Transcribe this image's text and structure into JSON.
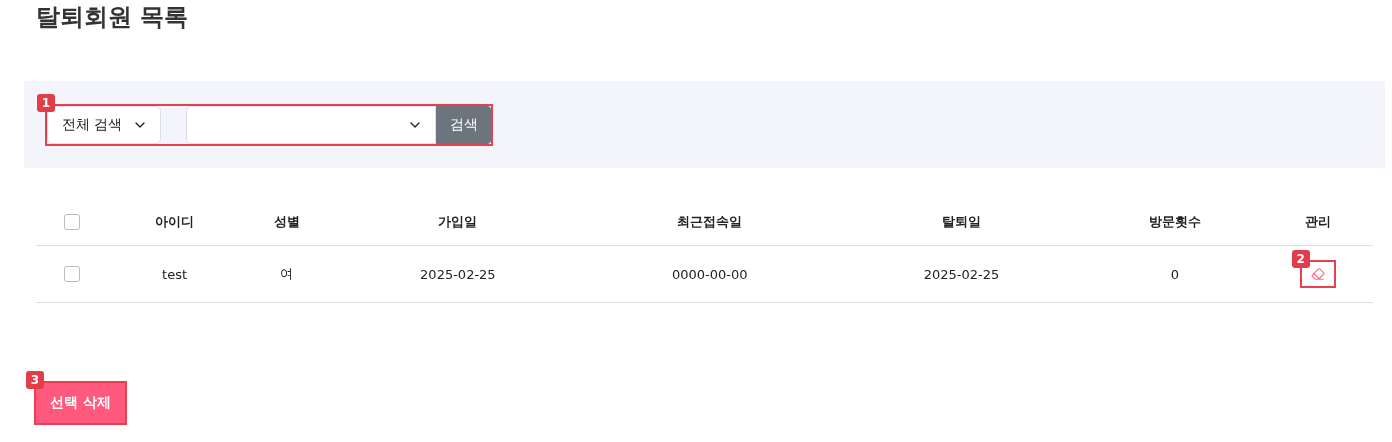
{
  "title": "탈퇴회원 목록",
  "search": {
    "marker": "1",
    "scope": "전체 검색",
    "button": "검색"
  },
  "table": {
    "columns": [
      "아이디",
      "성별",
      "가입일",
      "최근접속일",
      "탈퇴일",
      "방문횟수",
      "관리"
    ],
    "header_checked": false,
    "rows": [
      {
        "checked": false,
        "cells": [
          "test",
          "여",
          "2025-02-25",
          "0000-00-00",
          "2025-02-25",
          "0"
        ],
        "action_marker": "2"
      }
    ]
  },
  "delete_button": {
    "label": "선택 삭제",
    "marker": "3"
  }
}
